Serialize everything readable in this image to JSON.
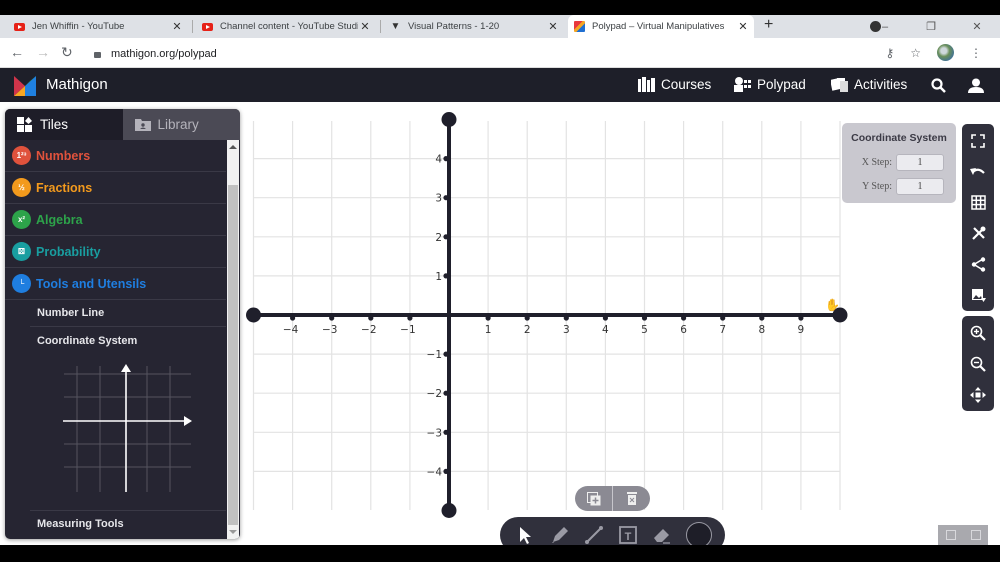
{
  "browser": {
    "tabs": [
      {
        "title": "Jen Whiffin - YouTube",
        "favicon": "youtube-icon"
      },
      {
        "title": "Channel content - YouTube Studio",
        "favicon": "youtube-icon"
      },
      {
        "title": "Visual Patterns - 1-20",
        "favicon": "visual-patterns-icon"
      },
      {
        "title": "Polypad – Virtual Manipulatives",
        "favicon": "mathigon-icon",
        "active": true
      }
    ],
    "new_tab": "+",
    "url": "mathigon.org/polypad",
    "window_controls": {
      "minimize": "–",
      "restore": "❐",
      "close": "✕"
    }
  },
  "header": {
    "brand": "Mathigon",
    "nav": [
      {
        "label": "Courses",
        "icon": "books-icon"
      },
      {
        "label": "Polypad",
        "icon": "polypad-icon"
      },
      {
        "label": "Activities",
        "icon": "cards-icon"
      }
    ]
  },
  "sidebar": {
    "tabs": [
      {
        "label": "Tiles",
        "icon": "tiles-icon",
        "active": true
      },
      {
        "label": "Library",
        "icon": "folder-icon",
        "active": false
      }
    ],
    "categories": [
      {
        "label": "Numbers",
        "color": "#e0523c",
        "icon_text": "1²³"
      },
      {
        "label": "Fractions",
        "color": "#f39a1d",
        "icon_text": "½"
      },
      {
        "label": "Algebra",
        "color": "#2da34a",
        "icon_text": "x²"
      },
      {
        "label": "Probability",
        "color": "#199ea0",
        "icon_text": "⚄"
      },
      {
        "label": "Tools and Utensils",
        "color": "#1f7ee0",
        "icon_text": "└"
      }
    ],
    "subitems": [
      "Number Line",
      "Coordinate System"
    ],
    "last_item": "Measuring Tools"
  },
  "coordinate_panel": {
    "title": "Coordinate System",
    "x_step_label": "X Step:",
    "x_step_value": "1",
    "y_step_label": "Y Step:",
    "y_step_value": "1"
  },
  "right_toolbar": {
    "group1": [
      "fullscreen-icon",
      "undo-icon",
      "grid-icon",
      "tools-icon",
      "share-icon",
      "image-export-icon"
    ],
    "group2": [
      "zoom-in-icon",
      "zoom-out-icon",
      "pan-icon"
    ]
  },
  "bottom_toolbar": {
    "selection_tools": [
      "duplicate-icon",
      "delete-icon"
    ],
    "drawing_tools": [
      "select-cursor-icon",
      "pen-icon",
      "line-icon",
      "text-box-icon",
      "eraser-icon"
    ],
    "current_color": "#1e1e28"
  },
  "chart_data": {
    "type": "scatter",
    "title": "",
    "xlabel": "",
    "ylabel": "",
    "x_ticks": [
      -4,
      -3,
      -2,
      -1,
      1,
      2,
      3,
      4,
      5,
      6,
      7,
      8,
      9
    ],
    "y_ticks": [
      4,
      3,
      2,
      1,
      -1,
      -2,
      -3,
      -4
    ],
    "x_step": 1,
    "y_step": 1,
    "xlim": [
      -5,
      10
    ],
    "ylim": [
      -5,
      5
    ],
    "grid": true,
    "axis_tick_labels_minus": "−"
  }
}
